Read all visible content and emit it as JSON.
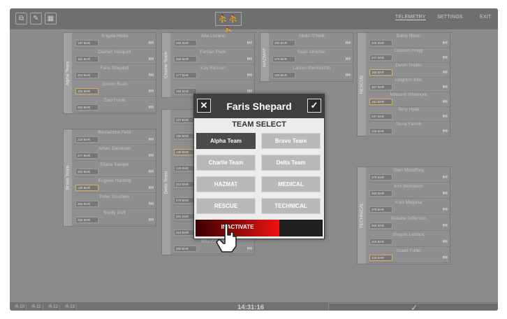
{
  "toolbar": {
    "logo_icon": "three-runners-logo"
  },
  "nav": [
    {
      "label": "TELEMETRY",
      "active": true
    },
    {
      "label": "SETTINGS",
      "active": false
    },
    {
      "label": "EXIT",
      "active": false
    }
  ],
  "teams": [
    {
      "name": "Alpha Team",
      "members": [
        {
          "name": "Angela Hicks",
          "pressure": "197 BAR",
          "warn": false
        },
        {
          "name": "Darnell Vasquez",
          "pressure": "161 BAR",
          "warn": false
        },
        {
          "name": "Faris Shepard",
          "pressure": "213 BAR",
          "warn": false
        },
        {
          "name": "Jordon Bush",
          "pressure": "102 BAR",
          "warn": true
        },
        {
          "name": "Zaid Frank",
          "pressure": "203 BAR",
          "warn": false
        }
      ]
    },
    {
      "name": "Bravo Team",
      "members": [
        {
          "name": "Bernardine Felix",
          "pressure": "218 BAR",
          "warn": false
        },
        {
          "name": "Amari Davidson",
          "pressure": "277 BAR",
          "warn": false
        },
        {
          "name": "Eliana Sawyer",
          "pressure": "263 BAR",
          "warn": false
        },
        {
          "name": "Eugene Harding",
          "pressure": "139 BAR",
          "warn": true
        },
        {
          "name": "Peter Goodwin",
          "pressure": "253 BAR",
          "warn": false
        },
        {
          "name": "Shelly Goff",
          "pressure": "208 BAR",
          "warn": false
        }
      ]
    },
    {
      "name": "Charlie Team",
      "members": [
        {
          "name": "Ada Lozano",
          "pressure": "255 BAR",
          "warn": false
        },
        {
          "name": "Farhan Plum",
          "pressure": "256 BAR",
          "warn": false
        },
        {
          "name": "Kay Ranson",
          "pressure": "177 BAR",
          "warn": false
        },
        {
          "name": "",
          "pressure": "164 BAR",
          "warn": false
        }
      ]
    },
    {
      "name": "Delta Team",
      "members": [
        {
          "name": "",
          "pressure": "227 BAR",
          "warn": false
        },
        {
          "name": "",
          "pressure": "185 BAR",
          "warn": false
        },
        {
          "name": "",
          "pressure": "149 BAR",
          "warn": true
        },
        {
          "name": "",
          "pressure": "120 BAR",
          "warn": false
        },
        {
          "name": "",
          "pressure": "213 BAR",
          "warn": false
        },
        {
          "name": "",
          "pressure": "272 BAR",
          "warn": false
        },
        {
          "name": "",
          "pressure": "201 BAR",
          "warn": false
        },
        {
          "name": "Milan Horne",
          "pressure": "214 BAR",
          "warn": false
        },
        {
          "name": "Rita Zuniga",
          "pressure": "280 BAR",
          "warn": false
        }
      ]
    },
    {
      "name": "HAZMAT",
      "members": [
        {
          "name": "Abdul O'Neill",
          "pressure": "260 BAR",
          "warn": false
        },
        {
          "name": "Sean Atherton",
          "pressure": "174 BAR",
          "warn": false
        },
        {
          "name": "Lauren Pemberton",
          "pressure": "323 BAR",
          "warn": false
        }
      ]
    },
    {
      "name": "RESCUE",
      "members": [
        {
          "name": "Daisy Nixon",
          "pressure": "225 BAR",
          "warn": false
        },
        {
          "name": "Cassius Hogg",
          "pressure": "247 BAR",
          "warn": false
        },
        {
          "name": "Devin Trujillo",
          "pressure": "158 BAR",
          "warn": true
        },
        {
          "name": "Leighton Ellis",
          "pressure": "167 BAR",
          "warn": false
        },
        {
          "name": "Millicent Whitmore",
          "pressure": "151 BAR",
          "warn": true
        },
        {
          "name": "Terry Hyde",
          "pressure": "227 BAR",
          "warn": false
        },
        {
          "name": "Nuraj Farrell",
          "pressure": "226 BAR",
          "warn": false
        }
      ]
    },
    {
      "name": "TECHNICAL",
      "members": [
        {
          "name": "Glen Mccaffrey",
          "pressure": "278 BAR",
          "warn": false
        },
        {
          "name": "Kim Mcmahon",
          "pressure": "293 BAR",
          "warn": false
        },
        {
          "name": "Kaci Magana",
          "pressure": "278 BAR",
          "warn": false
        },
        {
          "name": "Melabe Jefferson",
          "pressure": "264 BAR",
          "warn": false
        },
        {
          "name": "Shayan Leblanc",
          "pressure": "219 BAR",
          "warn": false
        },
        {
          "name": "Stuart Fuller",
          "pressure": "124 BAR",
          "warn": true
        }
      ]
    }
  ],
  "bottom": {
    "chips": [
      "R-10",
      "R-11",
      "R-12",
      "R-13"
    ],
    "clock": "14:31:16"
  },
  "modal": {
    "title": "Faris Shepard",
    "subtitle": "TEAM SELECT",
    "options": [
      {
        "label": "Alpha Team",
        "selected": true
      },
      {
        "label": "Bravo Team",
        "selected": false
      },
      {
        "label": "Charlie Team",
        "selected": false
      },
      {
        "label": "Delta Team",
        "selected": false
      },
      {
        "label": "HAZMAT",
        "selected": false
      },
      {
        "label": "MEDICAL",
        "selected": false
      },
      {
        "label": "RESCUE",
        "selected": false
      },
      {
        "label": "TECHNICAL",
        "selected": false
      }
    ],
    "inactivate_label": "INACTIVATE",
    "inactivate_progress": 0.66
  },
  "colors": {
    "inactivate_accent": "#ee1212",
    "warning_outline": "#d3b35c"
  }
}
